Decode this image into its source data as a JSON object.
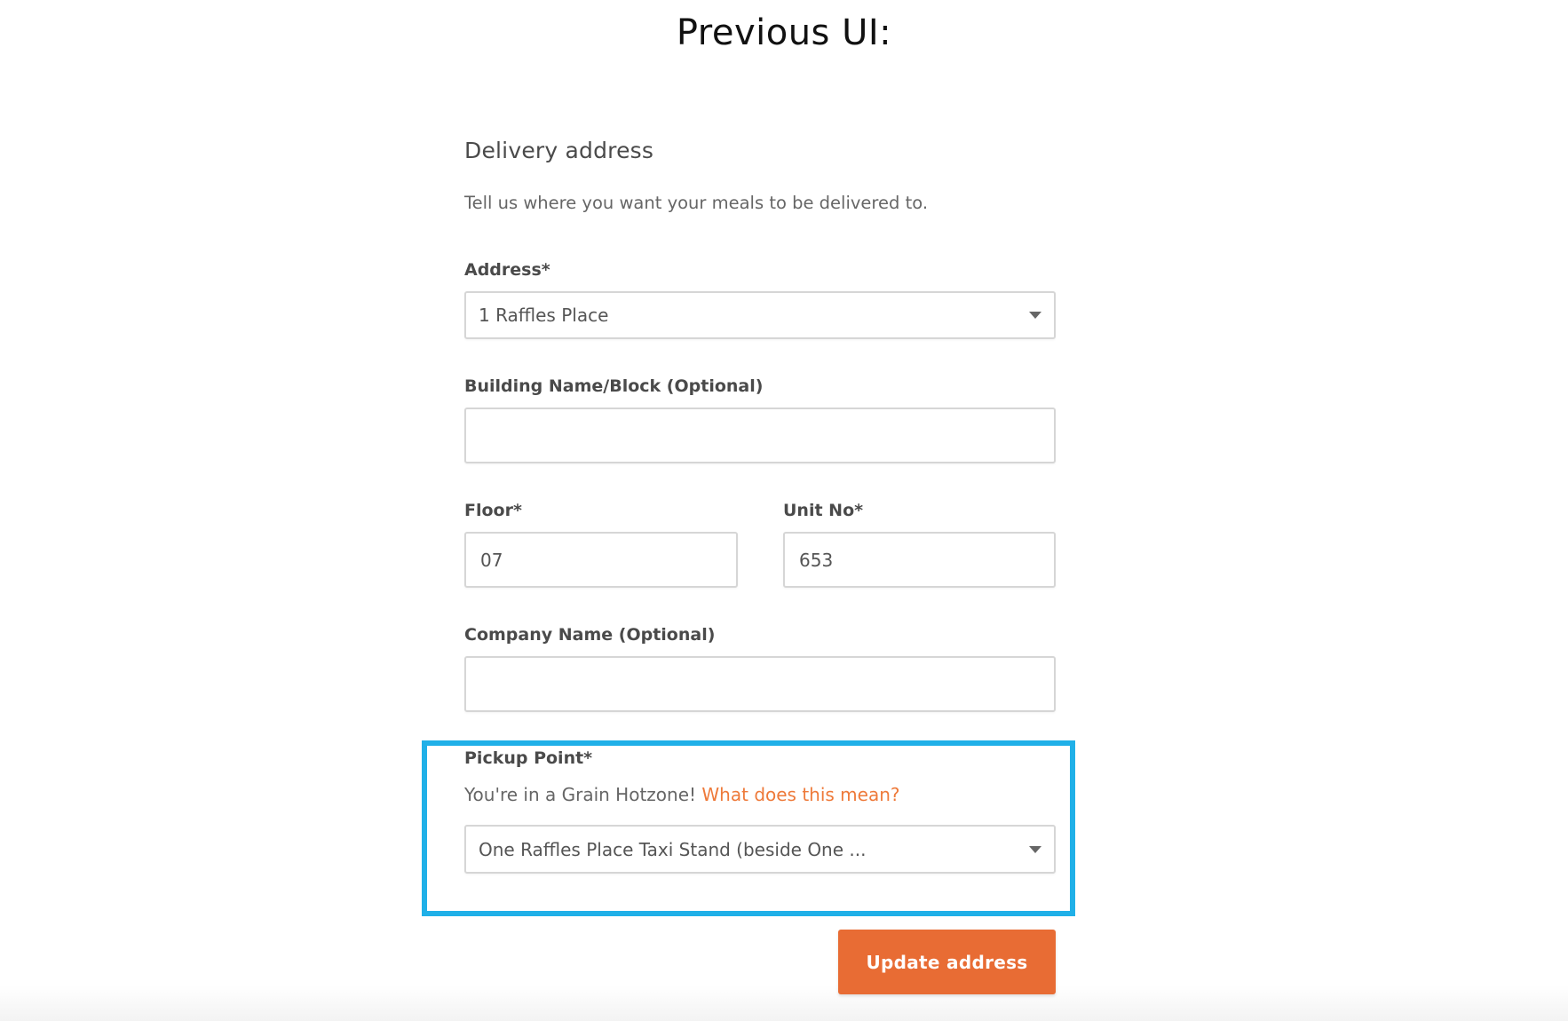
{
  "caption": "Previous UI:",
  "form": {
    "heading": "Delivery address",
    "subtext": "Tell us where you want your meals to be delivered to.",
    "address": {
      "label": "Address*",
      "value": "1 Raffles Place"
    },
    "building": {
      "label": "Building Name/Block (Optional)",
      "value": ""
    },
    "floor": {
      "label": "Floor*",
      "value": "07"
    },
    "unit": {
      "label": "Unit No*",
      "value": "653"
    },
    "company": {
      "label": "Company Name (Optional)",
      "value": ""
    },
    "pickup": {
      "label": "Pickup Point*",
      "hotzone_text": "You're in a Grain Hotzone! ",
      "hotzone_link": "What does this mean?",
      "value": "One Raffles Place Taxi Stand (beside One ..."
    },
    "submit_label": "Update address"
  },
  "colors": {
    "accent": "#e86c34",
    "link": "#ee7a3a",
    "highlight_border": "#20b0e8"
  }
}
